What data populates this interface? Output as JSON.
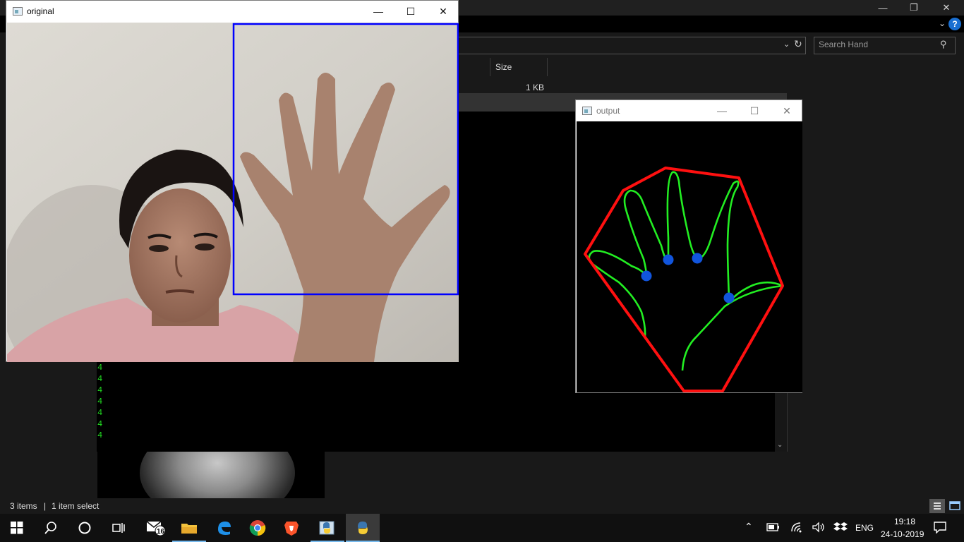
{
  "explorer": {
    "search_placeholder": "Search Hand",
    "column_size": "Size",
    "file_size": "1 KB",
    "status_items": "3 items",
    "status_separator": "|",
    "status_selected": "1 item select",
    "help_glyph": "?"
  },
  "console": {
    "lines": [
      "4",
      "4",
      "4",
      "4",
      "4",
      "4",
      "4"
    ]
  },
  "window_original": {
    "title": "original"
  },
  "window_output": {
    "title": "output"
  },
  "taskbar": {
    "mail_badge": "16",
    "language": "ENG",
    "time": "19:18",
    "date": "24-10-2019",
    "icons": [
      "windows-start-icon",
      "search-icon",
      "cortana-icon",
      "task-view-icon",
      "mail-icon",
      "file-explorer-icon",
      "edge-icon",
      "chrome-icon",
      "brave-icon",
      "python-idle-icon",
      "python-icon"
    ]
  },
  "colors": {
    "convex_hull": "#ff1010",
    "contour": "#22ee22",
    "defect_points": "#1155dd",
    "roi_box": "#0000ff",
    "console_text": "#22dd22"
  }
}
